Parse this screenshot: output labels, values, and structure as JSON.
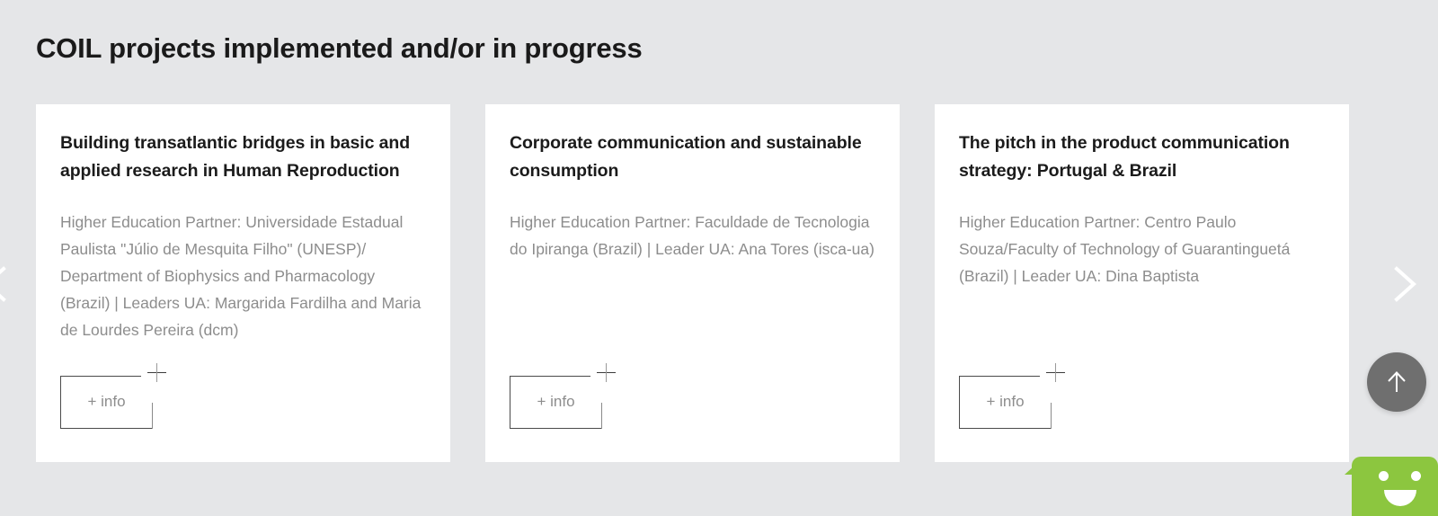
{
  "page": {
    "title": "COIL projects implemented and/or in progress",
    "background_color": "#e5e6e8"
  },
  "carousel": {
    "prev_label": "Previous",
    "next_label": "Next",
    "prev_icon": "chevron-left-icon",
    "next_icon": "chevron-right-icon",
    "cards": [
      {
        "title": "Building transatlantic bridges in basic and applied research in Human Reproduction",
        "description": "Higher Education Partner: Universidade Estadual Paulista \"Júlio de Mesquita Filho\" (UNESP)/ Department of Biophysics and Pharmacology (Brazil) | Leaders UA: Margarida Fardilha and Maria de Lourdes Pereira (dcm)",
        "button_label": "+ info",
        "button_icon": "plus-icon"
      },
      {
        "title": "Corporate communication and sustainable consumption",
        "description": "Higher Education Partner: Faculdade de Tecnologia do Ipiranga (Brazil) | Leader UA: Ana Tores (isca-ua)",
        "button_label": "+ info",
        "button_icon": "plus-icon"
      },
      {
        "title": "The pitch in the product communication strategy: Portugal & Brazil",
        "description": "Higher Education Partner: Centro Paulo Souza/Faculty of Technology of Guarantinguetá (Brazil) | Leader UA: Dina Baptista",
        "button_label": "+ info",
        "button_icon": "plus-icon"
      }
    ]
  },
  "widgets": {
    "scroll_top": {
      "label": "Back to top",
      "icon": "arrow-up-icon",
      "color": "#6f6f6f"
    },
    "chat": {
      "label": "Chat",
      "icon": "chat-smiley-icon",
      "color": "#8cc63f"
    }
  }
}
